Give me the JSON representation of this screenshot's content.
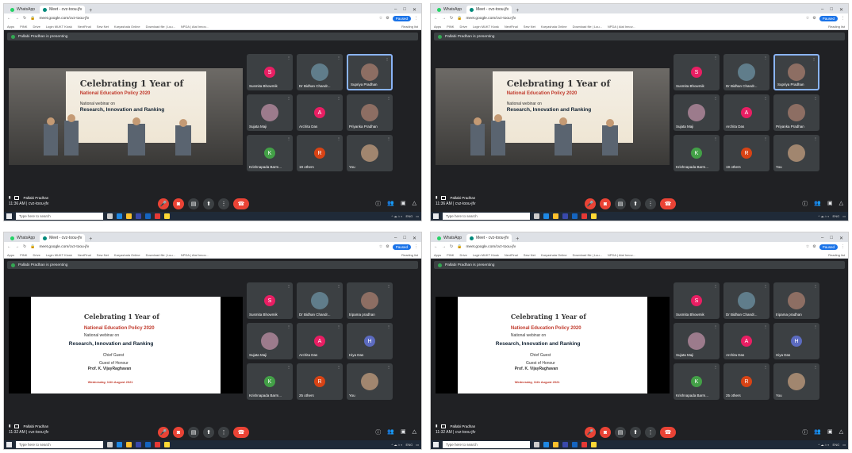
{
  "browser": {
    "tabs": [
      {
        "label": "WhatsApp",
        "color": "#25d366"
      },
      {
        "label": "Meet - cvz-toou-jfv",
        "color": "#00897b"
      }
    ],
    "url": "meet.google.com/cvz-toou-jfv",
    "profile_label": "Paused",
    "bookmarks": [
      "Apps",
      "PINK",
      "Drive",
      "Login MUKT Kiosk",
      "NextFinal",
      "Sew Net",
      "Karyashala Online",
      "Download file | Luu...",
      "NPDA | Atal Innov..."
    ],
    "reading_list": "Reading list"
  },
  "meet": {
    "presenting_banner": "Pallabi Pradhan is presenting",
    "presenter_label": "Pallabi Pradhan",
    "meeting_code": "cvz-toou-jfv",
    "others_label": "24 others",
    "you_label": "You"
  },
  "slide": {
    "title": "Celebrating 1 Year of",
    "subtitle": "National Education Policy 2020",
    "webinar_on": "National webinar on",
    "topic": "Research, Innovation and Ranking",
    "chief_guest": "Chief Guest",
    "guest_of_honour": "Guest of Honour",
    "guest_name": "Prof. K. VijayRaghavan",
    "date": "Wednesday, 11th August 2021"
  },
  "screens": [
    {
      "time": "11:36 AM",
      "participants": [
        {
          "name": "Susmita Bhowmik",
          "initial": "S",
          "color": "#e91e63"
        },
        {
          "name": "Dr Bidhan Chandr...",
          "initial": "",
          "color": "#607d8b"
        },
        {
          "name": "Supriya Pradhan",
          "initial": "",
          "color": "#8d6e63",
          "highlighted": true
        },
        {
          "name": "Sujata Maji",
          "initial": "",
          "color": "#3c4043"
        },
        {
          "name": "Archita Das",
          "initial": "A",
          "color": "#e91e63"
        },
        {
          "name": "Priyanka Pradhan",
          "initial": "",
          "color": "#8d6e63"
        },
        {
          "name": "Krishnapada Barm...",
          "initial": "K",
          "color": "#43a047"
        },
        {
          "name": "19 others",
          "initial": "R",
          "color": "#d84315"
        },
        {
          "name": "You",
          "initial": "",
          "color": "#a1866f"
        }
      ]
    },
    {
      "time": "11:36 AM",
      "participants": [
        {
          "name": "Susmita Bhowmik",
          "initial": "S",
          "color": "#e91e63"
        },
        {
          "name": "Dr Bidhan Chandr...",
          "initial": "",
          "color": "#607d8b"
        },
        {
          "name": "Supriya Pradhan",
          "initial": "",
          "color": "#8d6e63",
          "highlighted": true
        },
        {
          "name": "Sujata Maji",
          "initial": "",
          "color": "#3c4043"
        },
        {
          "name": "Archita Das",
          "initial": "A",
          "color": "#e91e63"
        },
        {
          "name": "Priyanka Pradhan",
          "initial": "",
          "color": "#8d6e63"
        },
        {
          "name": "Krishnapada Barm...",
          "initial": "K",
          "color": "#43a047"
        },
        {
          "name": "19 others",
          "initial": "R",
          "color": "#d84315"
        },
        {
          "name": "You",
          "initial": "",
          "color": "#a1866f"
        }
      ]
    },
    {
      "time": "11:32 AM",
      "participants": [
        {
          "name": "Susmita Bhowmik",
          "initial": "S",
          "color": "#e91e63"
        },
        {
          "name": "Dr Bidhan Chandr...",
          "initial": "",
          "color": "#607d8b"
        },
        {
          "name": "tripama pradhan",
          "initial": "",
          "color": "#8d6e63"
        },
        {
          "name": "Sujata Maji",
          "initial": "",
          "color": "#3c4043"
        },
        {
          "name": "Archita Das",
          "initial": "A",
          "color": "#e91e63"
        },
        {
          "name": "Hiya Das",
          "initial": "H",
          "color": "#5c6bc0"
        },
        {
          "name": "Krishnapada Barm...",
          "initial": "K",
          "color": "#43a047"
        },
        {
          "name": "25 others",
          "initial": "R",
          "color": "#d84315"
        },
        {
          "name": "You",
          "initial": "",
          "color": "#a1866f"
        }
      ]
    },
    {
      "time": "11:32 AM",
      "participants": [
        {
          "name": "Susmita Bhowmik",
          "initial": "S",
          "color": "#e91e63"
        },
        {
          "name": "Dr Bidhan Chandr...",
          "initial": "",
          "color": "#607d8b"
        },
        {
          "name": "tripama pradhan",
          "initial": "",
          "color": "#8d6e63"
        },
        {
          "name": "Sujata Maji",
          "initial": "",
          "color": "#3c4043"
        },
        {
          "name": "Archita Das",
          "initial": "A",
          "color": "#e91e63"
        },
        {
          "name": "Hiya Das",
          "initial": "H",
          "color": "#5c6bc0"
        },
        {
          "name": "Krishnapada Barm...",
          "initial": "K",
          "color": "#43a047"
        },
        {
          "name": "25 others",
          "initial": "R",
          "color": "#d84315"
        },
        {
          "name": "You",
          "initial": "",
          "color": "#a1866f"
        }
      ]
    }
  ],
  "taskbar": {
    "search_placeholder": "Type here to search",
    "lang": "ENG"
  }
}
